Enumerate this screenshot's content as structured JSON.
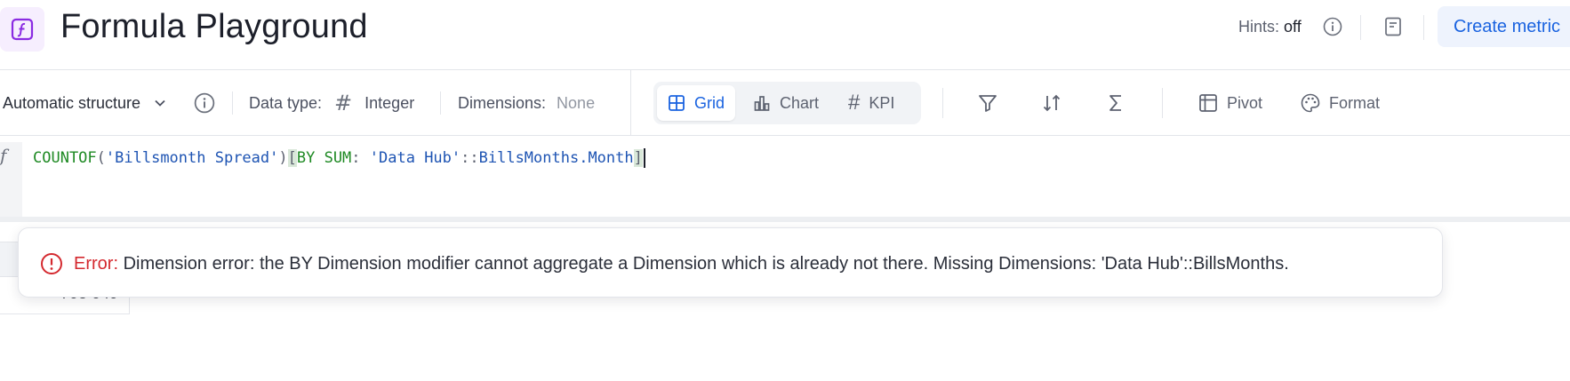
{
  "header": {
    "app_icon": "formula-icon",
    "title": "Formula Playground",
    "hints_label": "Hints:",
    "hints_value": "off",
    "info_icon": "info-icon",
    "doc_icon": "document-icon",
    "create_button_label": "Create metric"
  },
  "toolbar": {
    "structure_label": "Automatic structure",
    "data_type_label": "Data type:",
    "data_type_value": "Integer",
    "dimensions_label": "Dimensions:",
    "dimensions_value": "None",
    "views": [
      {
        "label": "Grid",
        "icon": "grid-icon",
        "active": true
      },
      {
        "label": "Chart",
        "icon": "bar-chart-icon",
        "active": false
      },
      {
        "label": "KPI",
        "icon": "hash-icon",
        "active": false
      }
    ],
    "filter_icon": "filter-icon",
    "sort_icon": "sort-icon",
    "sum_icon": "sigma-icon",
    "pivot_label": "Pivot",
    "format_label": "Format"
  },
  "editor": {
    "gutter_mark": "f",
    "tokens": {
      "fn": "COUNTOF",
      "open_paren": "(",
      "arg": "'Billsmonth Spread'",
      "close_paren": ")",
      "open_bracket": "[",
      "by_kw": "BY SUM",
      "colon": ": ",
      "dim_ns": "'Data Hub'",
      "sep": "::",
      "dim_name": "BillsMonths.Month",
      "close_bracket": "]"
    }
  },
  "grid": {
    "partial_value": "703 049"
  },
  "error": {
    "title": "Error:",
    "message": "Dimension error: the BY Dimension modifier cannot aggregate a Dimension which is already not there. Missing Dimensions: 'Data Hub'::BillsMonths."
  },
  "colors": {
    "accent": "#1a63e0",
    "error": "#d4292f",
    "function_token": "#1f8a24",
    "string_token": "#1e54b3",
    "app_icon_bg": "#f6eefe",
    "app_icon_fg": "#8a2be2"
  }
}
